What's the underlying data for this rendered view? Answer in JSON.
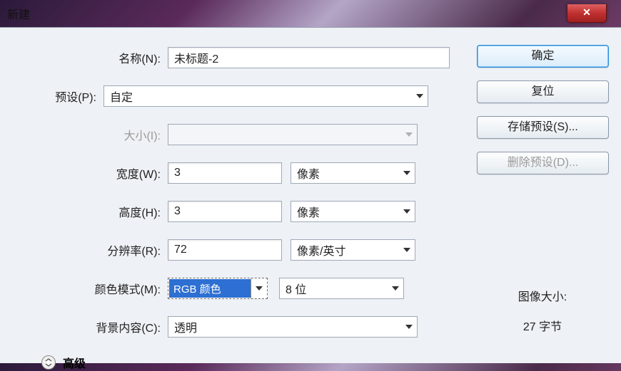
{
  "window": {
    "title": "新建"
  },
  "labels": {
    "name": "名称(N):",
    "preset": "预设(P):",
    "size": "大小(I):",
    "width": "宽度(W):",
    "height": "高度(H):",
    "resolution": "分辨率(R):",
    "colorMode": "颜色模式(M):",
    "background": "背景内容(C):",
    "advanced": "高级"
  },
  "values": {
    "name": "未标题-2",
    "preset": "自定",
    "size": "",
    "width": "3",
    "height": "3",
    "resolution": "72",
    "colorMode": "RGB 颜色",
    "bits": "8 位",
    "background": "透明",
    "widthUnit": "像素",
    "heightUnit": "像素",
    "resUnit": "像素/英寸"
  },
  "buttons": {
    "ok": "确定",
    "reset": "复位",
    "savePreset": "存储预设(S)...",
    "deletePreset": "删除预设(D)..."
  },
  "imageSize": {
    "label": "图像大小:",
    "value": "27 字节"
  }
}
